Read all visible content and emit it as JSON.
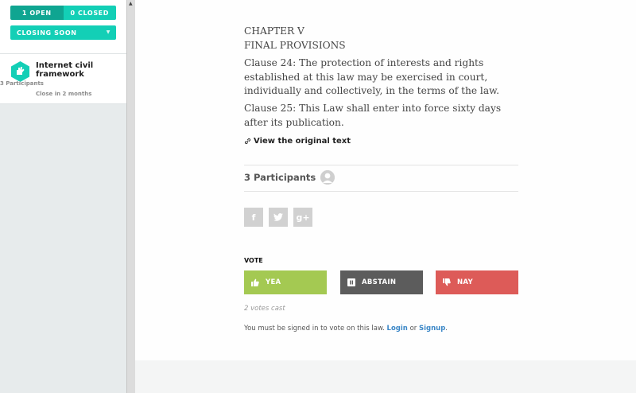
{
  "sidebar": {
    "filter_open_label": "1 OPEN",
    "filter_closed_label": "0 CLOSED",
    "sort_label": "CLOSING SOON",
    "laws": [
      {
        "title": "Internet civil framework",
        "participants": "3 Participants",
        "closes": "Close in 2 months"
      }
    ]
  },
  "law": {
    "chapter": "CHAPTER V",
    "section": "FINAL PROVISIONS",
    "clause_24": "Clause 24: The protection of interests and rights established at this law may be exercised in court, individually and collectively, in the terms of the law.",
    "clause_25": "Clause 25: This Law shall enter into force sixty days after its publication.",
    "original_link": "View the original text"
  },
  "participants_label": "3 Participants",
  "share": {
    "facebook": "f",
    "twitter": "t",
    "google": "g+"
  },
  "vote": {
    "label": "VOTE",
    "yea": "YEA",
    "abstain": "ABSTAIN",
    "nay": "NAY",
    "votes_cast": "2 votes cast",
    "signin_prefix": "You must be signed in to vote on this law.",
    "login": "Login",
    "or": "or",
    "signup": "Signup",
    "period": "."
  },
  "colors": {
    "accent_teal": "#13cfb6",
    "accent_teal_dark": "#0fa591",
    "yea": "#a4c952",
    "abstain": "#5c5c5c",
    "nay": "#dd5b58",
    "link": "#3b87c7"
  },
  "icons": {
    "law_item": "hand-hexagon-icon",
    "original_link": "link-icon",
    "avatar": "user-avatar-icon",
    "yea": "thumbs-up-icon",
    "abstain": "pause-icon",
    "nay": "thumbs-down-icon",
    "sort": "chevron-down-icon"
  }
}
